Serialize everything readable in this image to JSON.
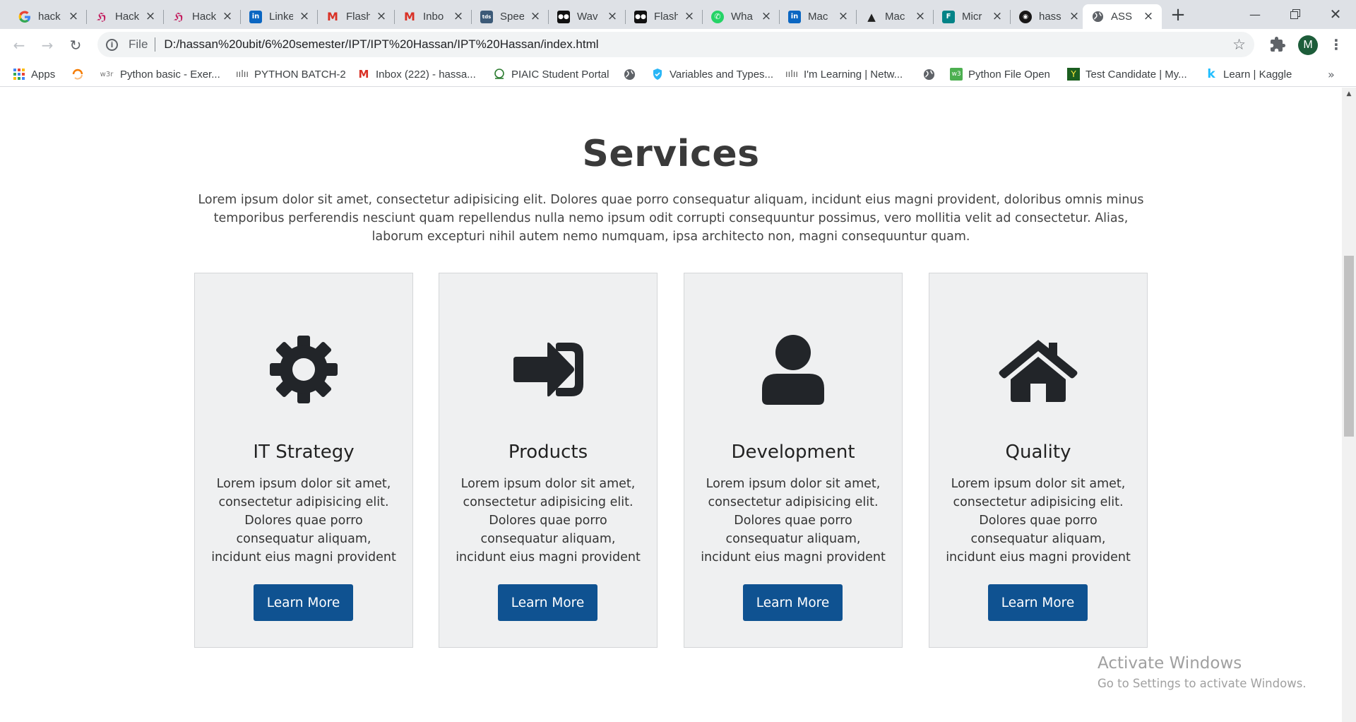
{
  "browser": {
    "tabs": [
      {
        "label": "hack",
        "favicon": "google-icon",
        "color": "#4285f4"
      },
      {
        "label": "Hack",
        "favicon": "hackerrank-icon",
        "color": "#c2185b"
      },
      {
        "label": "Hack",
        "favicon": "hackerrank-icon",
        "color": "#c2185b"
      },
      {
        "label": "Linke",
        "favicon": "linkedin-icon",
        "color": "#0a66c2"
      },
      {
        "label": "Flash",
        "favicon": "gmail-icon",
        "color": "#d93025"
      },
      {
        "label": "Inbo",
        "favicon": "gmail-icon",
        "color": "#d93025"
      },
      {
        "label": "Spee",
        "favicon": "tds-icon",
        "color": "#3c5a78"
      },
      {
        "label": "Wav",
        "favicon": "medium-icon",
        "color": "#111111"
      },
      {
        "label": "Flash",
        "favicon": "medium-icon",
        "color": "#111111"
      },
      {
        "label": "Wha",
        "favicon": "whatsapp-icon",
        "color": "#25d366"
      },
      {
        "label": "Mac",
        "favicon": "linkedin-icon",
        "color": "#0a66c2"
      },
      {
        "label": "Mac",
        "favicon": "mountain-icon",
        "color": "#222222"
      },
      {
        "label": "Micr",
        "favicon": "forms-icon",
        "color": "#038387"
      },
      {
        "label": "hass",
        "favicon": "github-icon",
        "color": "#181717"
      },
      {
        "label": "ASS",
        "favicon": "globe-icon",
        "color": "#5f6368",
        "active": true
      }
    ],
    "address": {
      "scheme": "File",
      "url": "D:/hassan%20ubit/6%20semester/IPT/IPT%20Hassan/IPT%20Hassan/index.html"
    },
    "profile_initial": "M",
    "bookmarks": [
      {
        "label": "Apps",
        "icon": "apps-grid-icon"
      },
      {
        "label": "",
        "icon": "circle-loader-icon"
      },
      {
        "label": "Python basic - Exer...",
        "icon": "w3r-icon",
        "icon_text": "w3r"
      },
      {
        "label": "PYTHON BATCH-2",
        "icon": "waves-icon"
      },
      {
        "label": "Inbox (222) - hassa...",
        "icon": "gmail-icon"
      },
      {
        "label": "PIAIC Student Portal",
        "icon": "piaic-icon"
      },
      {
        "label": "",
        "icon": "globe-icon"
      },
      {
        "label": "Variables and Types...",
        "icon": "shield-icon"
      },
      {
        "label": "I'm Learning | Netw...",
        "icon": "waves-icon"
      },
      {
        "label": "",
        "icon": "globe-icon"
      },
      {
        "label": "Python File Open",
        "icon": "w3schools-icon"
      },
      {
        "label": "Test Candidate | My...",
        "icon": "hackerrank-icon"
      },
      {
        "label": "Learn | Kaggle",
        "icon": "kaggle-icon"
      }
    ]
  },
  "services": {
    "title": "Services",
    "intro": "Lorem ipsum dolor sit amet, consectetur adipisicing elit. Dolores quae porro consequatur aliquam, incidunt eius magni provident, doloribus omnis minus temporibus perferendis nesciunt quam repellendus nulla nemo ipsum odit corrupti consequuntur possimus, vero mollitia velit ad consectetur. Alias, laborum excepturi nihil autem nemo numquam, ipsa architecto non, magni consequuntur quam.",
    "cards": [
      {
        "icon": "gear-icon",
        "title": "IT Strategy",
        "text": "Lorem ipsum dolor sit amet, consectetur adipisicing elit. Dolores quae porro consequatur aliquam, incidunt eius magni provident",
        "button": "Learn More"
      },
      {
        "icon": "sign-in-icon",
        "title": "Products",
        "text": "Lorem ipsum dolor sit amet, consectetur adipisicing elit. Dolores quae porro consequatur aliquam, incidunt eius magni provident",
        "button": "Learn More"
      },
      {
        "icon": "user-icon",
        "title": "Development",
        "text": "Lorem ipsum dolor sit amet, consectetur adipisicing elit. Dolores quae porro consequatur aliquam, incidunt eius magni provident",
        "button": "Learn More"
      },
      {
        "icon": "home-icon",
        "title": "Quality",
        "text": "Lorem ipsum dolor sit amet, consectetur adipisicing elit. Dolores quae porro consequatur aliquam, incidunt eius magni provident",
        "button": "Learn More"
      }
    ],
    "button_color": "#0f5291",
    "card_background": "#eff0f1"
  },
  "watermark": {
    "line1": "Activate Windows",
    "line2": "Go to Settings to activate Windows."
  }
}
